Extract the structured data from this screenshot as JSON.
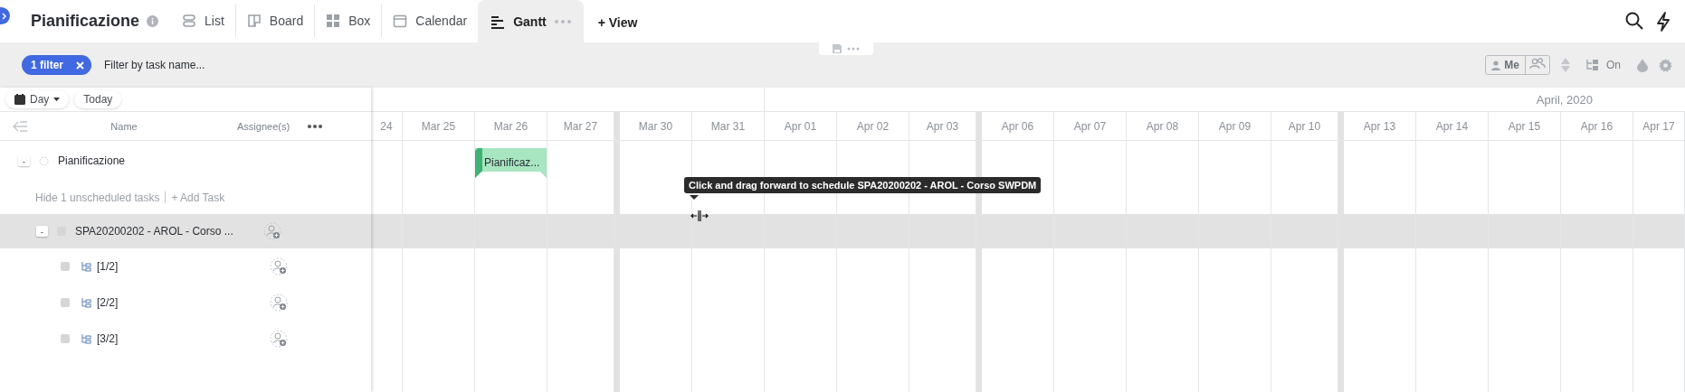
{
  "header": {
    "title": "Pianificazione",
    "tabs": [
      {
        "label": "List",
        "kind": "list",
        "selected": false
      },
      {
        "label": "Board",
        "kind": "board",
        "selected": false
      },
      {
        "label": "Box",
        "kind": "box",
        "selected": false
      },
      {
        "label": "Calendar",
        "kind": "calendar",
        "selected": false
      },
      {
        "label": "Gantt",
        "kind": "gantt",
        "selected": true
      }
    ],
    "add_view": "+ View"
  },
  "toolbar": {
    "filter_chip": "1 filter",
    "filter_placeholder": "Filter by task name...",
    "me_toggle": "Me",
    "subtasks_toggle": "On"
  },
  "left_panel": {
    "scale_button": "Day",
    "today_button": "Today",
    "columns": [
      "Name",
      "Assignee(s)"
    ],
    "project": {
      "name": "Pianificazione",
      "expanded": true,
      "toggle": "-"
    },
    "unscheduled": {
      "hide_link": "Hide 1 unscheduled tasks",
      "add_task": "+ Add Task"
    },
    "tasks": [
      {
        "name": "SPA20200202 - AROL - Corso ...",
        "expanded": true,
        "toggle": "-",
        "hovered": true,
        "children": [
          {
            "name": "[1/2]"
          },
          {
            "name": "[2/2]"
          },
          {
            "name": "[3/2]"
          }
        ]
      }
    ]
  },
  "timeline": {
    "month": "April, 2020",
    "columns": [
      {
        "kind": "day",
        "label": "24"
      },
      {
        "kind": "day",
        "label": "Mar 25"
      },
      {
        "kind": "day",
        "label": "Mar 26"
      },
      {
        "kind": "day",
        "label": "Mar 27"
      },
      {
        "kind": "gap"
      },
      {
        "kind": "day",
        "label": "Mar 30"
      },
      {
        "kind": "day",
        "label": "Mar 31"
      },
      {
        "kind": "day",
        "label": "Apr 01"
      },
      {
        "kind": "day",
        "label": "Apr 02"
      },
      {
        "kind": "day",
        "label": "Apr 03"
      },
      {
        "kind": "gap"
      },
      {
        "kind": "day",
        "label": "Apr 06"
      },
      {
        "kind": "day",
        "label": "Apr 07"
      },
      {
        "kind": "day",
        "label": "Apr 08"
      },
      {
        "kind": "day",
        "label": "Apr 09"
      },
      {
        "kind": "day",
        "label": "Apr 10"
      },
      {
        "kind": "gap"
      },
      {
        "kind": "day",
        "label": "Apr 13"
      },
      {
        "kind": "day",
        "label": "Apr 14"
      },
      {
        "kind": "day",
        "label": "Apr 15"
      },
      {
        "kind": "day",
        "label": "Apr 16"
      },
      {
        "kind": "day",
        "label": "Apr 17"
      }
    ],
    "bar_label": "Pianificaz...",
    "tooltip": "Click and drag forward to schedule SPA20200202 - AROL - Corso SWPDM"
  }
}
